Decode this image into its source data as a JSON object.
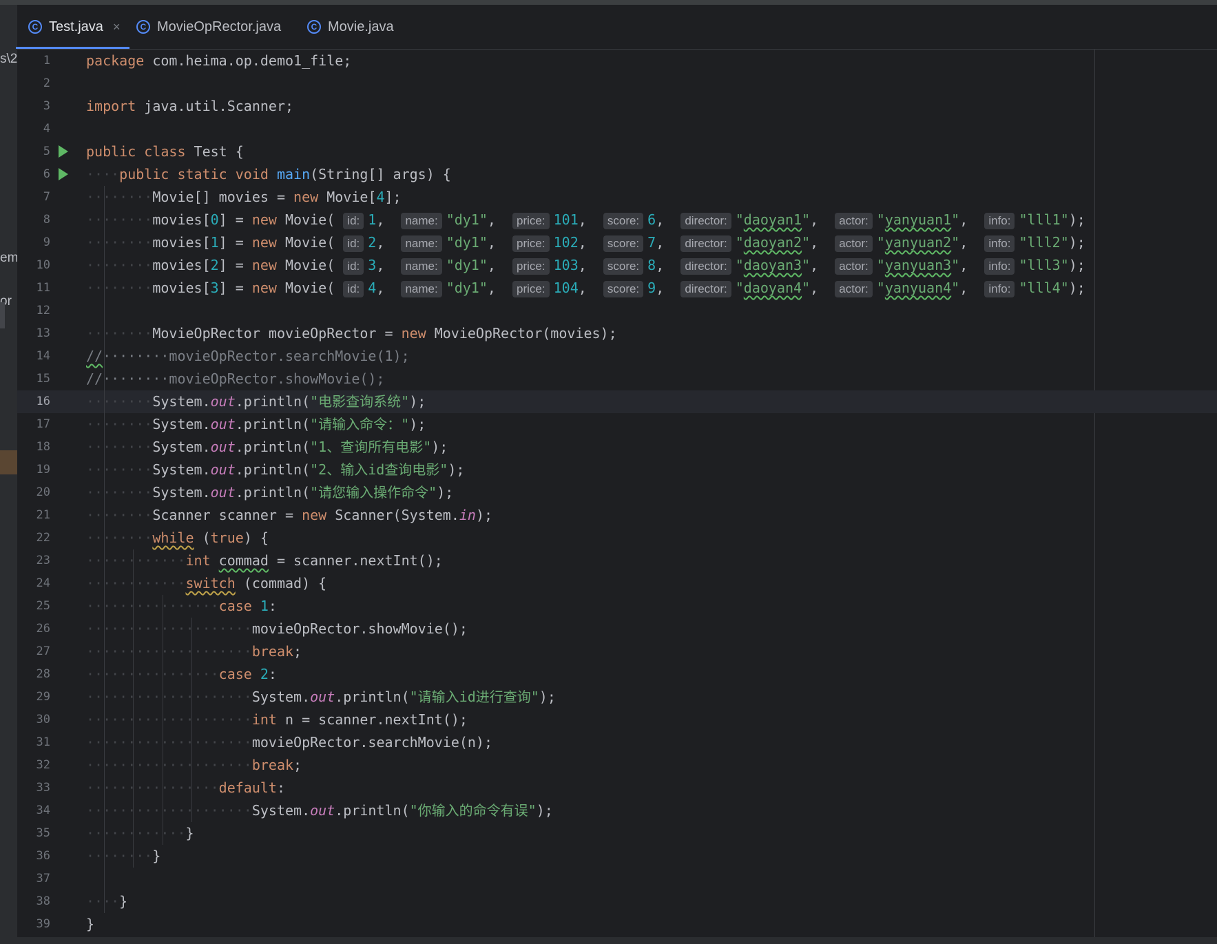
{
  "tabs": [
    {
      "label": "Test.java",
      "active": true,
      "close": "×"
    },
    {
      "label": "MovieOpRector.java",
      "active": false
    },
    {
      "label": "Movie.java",
      "active": false
    }
  ],
  "left_panel_fragments": [
    "s\\2",
    "em",
    "or"
  ],
  "code_lines": [
    {
      "n": "1",
      "parts": [
        {
          "t": "package",
          "c": "kw"
        },
        {
          "t": " com.heima.op.demo1_file;"
        }
      ]
    },
    {
      "n": "2",
      "parts": []
    },
    {
      "n": "3",
      "parts": [
        {
          "t": "import",
          "c": "kw"
        },
        {
          "t": " java.util.Scanner;"
        }
      ]
    },
    {
      "n": "4",
      "parts": []
    },
    {
      "n": "5",
      "run": true,
      "parts": [
        {
          "t": "public class",
          "c": "kw"
        },
        {
          "t": " Test {"
        }
      ]
    },
    {
      "n": "6",
      "run": true,
      "parts": [
        {
          "t": "····",
          "c": "dot"
        },
        {
          "t": "public static void",
          "c": "kw"
        },
        {
          "t": " "
        },
        {
          "t": "main",
          "c": "fn"
        },
        {
          "t": "(String[] args) {"
        }
      ]
    },
    {
      "n": "7",
      "parts": [
        {
          "t": "········",
          "c": "dot"
        },
        {
          "t": "Movie[] movies = "
        },
        {
          "t": "new",
          "c": "kw"
        },
        {
          "t": " Movie["
        },
        {
          "t": "4",
          "c": "num"
        },
        {
          "t": "];"
        }
      ]
    },
    {
      "n": "8",
      "parts": [
        {
          "t": "········",
          "c": "dot"
        },
        {
          "t": "movies["
        },
        {
          "t": "0",
          "c": "num"
        },
        {
          "t": "] = "
        },
        {
          "t": "new",
          "c": "kw"
        },
        {
          "t": " Movie( "
        },
        {
          "h": "id:"
        },
        {
          "t": "1",
          "c": "num"
        },
        {
          "t": ",  "
        },
        {
          "h": "name:"
        },
        {
          "t": "\"dy1\"",
          "c": "str"
        },
        {
          "t": ",  "
        },
        {
          "h": "price:"
        },
        {
          "t": "101",
          "c": "num"
        },
        {
          "t": ",  "
        },
        {
          "h": "score:"
        },
        {
          "t": "6",
          "c": "num"
        },
        {
          "t": ",  "
        },
        {
          "h": "director:"
        },
        {
          "t": "\"",
          "c": "str"
        },
        {
          "t": "daoyan1",
          "c": "str squig"
        },
        {
          "t": "\"",
          "c": "str"
        },
        {
          "t": ",  "
        },
        {
          "h": "actor:"
        },
        {
          "t": "\"",
          "c": "str"
        },
        {
          "t": "yanyuan1",
          "c": "str squig"
        },
        {
          "t": "\"",
          "c": "str"
        },
        {
          "t": ",  "
        },
        {
          "h": "info:"
        },
        {
          "t": "\"lll1\"",
          "c": "str"
        },
        {
          "t": ");"
        }
      ]
    },
    {
      "n": "9",
      "parts": [
        {
          "t": "········",
          "c": "dot"
        },
        {
          "t": "movies["
        },
        {
          "t": "1",
          "c": "num"
        },
        {
          "t": "] = "
        },
        {
          "t": "new",
          "c": "kw"
        },
        {
          "t": " Movie( "
        },
        {
          "h": "id:"
        },
        {
          "t": "2",
          "c": "num"
        },
        {
          "t": ",  "
        },
        {
          "h": "name:"
        },
        {
          "t": "\"dy1\"",
          "c": "str"
        },
        {
          "t": ",  "
        },
        {
          "h": "price:"
        },
        {
          "t": "102",
          "c": "num"
        },
        {
          "t": ",  "
        },
        {
          "h": "score:"
        },
        {
          "t": "7",
          "c": "num"
        },
        {
          "t": ",  "
        },
        {
          "h": "director:"
        },
        {
          "t": "\"",
          "c": "str"
        },
        {
          "t": "daoyan2",
          "c": "str squig"
        },
        {
          "t": "\"",
          "c": "str"
        },
        {
          "t": ",  "
        },
        {
          "h": "actor:"
        },
        {
          "t": "\"",
          "c": "str"
        },
        {
          "t": "yanyuan2",
          "c": "str squig"
        },
        {
          "t": "\"",
          "c": "str"
        },
        {
          "t": ",  "
        },
        {
          "h": "info:"
        },
        {
          "t": "\"lll2\"",
          "c": "str"
        },
        {
          "t": ");"
        }
      ]
    },
    {
      "n": "10",
      "parts": [
        {
          "t": "········",
          "c": "dot"
        },
        {
          "t": "movies["
        },
        {
          "t": "2",
          "c": "num"
        },
        {
          "t": "] = "
        },
        {
          "t": "new",
          "c": "kw"
        },
        {
          "t": " Movie( "
        },
        {
          "h": "id:"
        },
        {
          "t": "3",
          "c": "num"
        },
        {
          "t": ",  "
        },
        {
          "h": "name:"
        },
        {
          "t": "\"dy1\"",
          "c": "str"
        },
        {
          "t": ",  "
        },
        {
          "h": "price:"
        },
        {
          "t": "103",
          "c": "num"
        },
        {
          "t": ",  "
        },
        {
          "h": "score:"
        },
        {
          "t": "8",
          "c": "num"
        },
        {
          "t": ",  "
        },
        {
          "h": "director:"
        },
        {
          "t": "\"",
          "c": "str"
        },
        {
          "t": "daoyan3",
          "c": "str squig"
        },
        {
          "t": "\"",
          "c": "str"
        },
        {
          "t": ",  "
        },
        {
          "h": "actor:"
        },
        {
          "t": "\"",
          "c": "str"
        },
        {
          "t": "yanyuan3",
          "c": "str squig"
        },
        {
          "t": "\"",
          "c": "str"
        },
        {
          "t": ",  "
        },
        {
          "h": "info:"
        },
        {
          "t": "\"lll3\"",
          "c": "str"
        },
        {
          "t": ");"
        }
      ]
    },
    {
      "n": "11",
      "parts": [
        {
          "t": "········",
          "c": "dot"
        },
        {
          "t": "movies["
        },
        {
          "t": "3",
          "c": "num"
        },
        {
          "t": "] = "
        },
        {
          "t": "new",
          "c": "kw"
        },
        {
          "t": " Movie( "
        },
        {
          "h": "id:"
        },
        {
          "t": "4",
          "c": "num"
        },
        {
          "t": ",  "
        },
        {
          "h": "name:"
        },
        {
          "t": "\"dy1\"",
          "c": "str"
        },
        {
          "t": ",  "
        },
        {
          "h": "price:"
        },
        {
          "t": "104",
          "c": "num"
        },
        {
          "t": ",  "
        },
        {
          "h": "score:"
        },
        {
          "t": "9",
          "c": "num"
        },
        {
          "t": ",  "
        },
        {
          "h": "director:"
        },
        {
          "t": "\"",
          "c": "str"
        },
        {
          "t": "daoyan4",
          "c": "str squig"
        },
        {
          "t": "\"",
          "c": "str"
        },
        {
          "t": ",  "
        },
        {
          "h": "actor:"
        },
        {
          "t": "\"",
          "c": "str"
        },
        {
          "t": "yanyuan4",
          "c": "str squig"
        },
        {
          "t": "\"",
          "c": "str"
        },
        {
          "t": ",  "
        },
        {
          "h": "info:"
        },
        {
          "t": "\"lll4\"",
          "c": "str"
        },
        {
          "t": ");"
        }
      ]
    },
    {
      "n": "12",
      "parts": []
    },
    {
      "n": "13",
      "parts": [
        {
          "t": "········",
          "c": "dot"
        },
        {
          "t": "MovieOpRector movieOpRector = "
        },
        {
          "t": "new",
          "c": "kw"
        },
        {
          "t": " MovieOpRector(movies);"
        }
      ]
    },
    {
      "n": "14",
      "parts": [
        {
          "t": "//",
          "c": "cmt squig"
        },
        {
          "t": "········movieOpRector.searchMovie(1);",
          "c": "cmt"
        }
      ]
    },
    {
      "n": "15",
      "parts": [
        {
          "t": "//········movieOpRector.showMovie();",
          "c": "cmt"
        }
      ]
    },
    {
      "n": "16",
      "current": true,
      "parts": [
        {
          "t": "········",
          "c": "dot"
        },
        {
          "t": "System."
        },
        {
          "t": "out",
          "c": "fld"
        },
        {
          "t": ".println("
        },
        {
          "t": "\"电影查询系统\"",
          "c": "str"
        },
        {
          "t": ");"
        }
      ]
    },
    {
      "n": "17",
      "parts": [
        {
          "t": "········",
          "c": "dot"
        },
        {
          "t": "System."
        },
        {
          "t": "out",
          "c": "fld"
        },
        {
          "t": ".println("
        },
        {
          "t": "\"请输入命令：\"",
          "c": "str"
        },
        {
          "t": ");"
        }
      ]
    },
    {
      "n": "18",
      "parts": [
        {
          "t": "········",
          "c": "dot"
        },
        {
          "t": "System."
        },
        {
          "t": "out",
          "c": "fld"
        },
        {
          "t": ".println("
        },
        {
          "t": "\"1、查询所有电影\"",
          "c": "str"
        },
        {
          "t": ");"
        }
      ]
    },
    {
      "n": "19",
      "parts": [
        {
          "t": "········",
          "c": "dot"
        },
        {
          "t": "System."
        },
        {
          "t": "out",
          "c": "fld"
        },
        {
          "t": ".println("
        },
        {
          "t": "\"2、输入id查询电影\"",
          "c": "str"
        },
        {
          "t": ");"
        }
      ]
    },
    {
      "n": "20",
      "parts": [
        {
          "t": "········",
          "c": "dot"
        },
        {
          "t": "System."
        },
        {
          "t": "out",
          "c": "fld"
        },
        {
          "t": ".println("
        },
        {
          "t": "\"请您输入操作命令\"",
          "c": "str"
        },
        {
          "t": ");"
        }
      ]
    },
    {
      "n": "21",
      "parts": [
        {
          "t": "········",
          "c": "dot"
        },
        {
          "t": "Scanner scanner = "
        },
        {
          "t": "new",
          "c": "kw"
        },
        {
          "t": " Scanner(System."
        },
        {
          "t": "in",
          "c": "fld"
        },
        {
          "t": ");"
        }
      ]
    },
    {
      "n": "22",
      "parts": [
        {
          "t": "········",
          "c": "dot"
        },
        {
          "t": "while",
          "c": "kw squigw"
        },
        {
          "t": " ("
        },
        {
          "t": "true",
          "c": "kw"
        },
        {
          "t": ") {"
        }
      ]
    },
    {
      "n": "23",
      "parts": [
        {
          "t": "············",
          "c": "dot"
        },
        {
          "t": "int",
          "c": "kw"
        },
        {
          "t": " "
        },
        {
          "t": "commad",
          "c": "squig"
        },
        {
          "t": " = scanner.nextInt();"
        }
      ]
    },
    {
      "n": "24",
      "parts": [
        {
          "t": "············",
          "c": "dot"
        },
        {
          "t": "switch",
          "c": "kw squigw"
        },
        {
          "t": " (commad) {"
        }
      ]
    },
    {
      "n": "25",
      "parts": [
        {
          "t": "················",
          "c": "dot"
        },
        {
          "t": "case",
          "c": "kw"
        },
        {
          "t": " "
        },
        {
          "t": "1",
          "c": "num"
        },
        {
          "t": ":"
        }
      ]
    },
    {
      "n": "26",
      "parts": [
        {
          "t": "····················",
          "c": "dot"
        },
        {
          "t": "movieOpRector.showMovie();"
        }
      ]
    },
    {
      "n": "27",
      "parts": [
        {
          "t": "····················",
          "c": "dot"
        },
        {
          "t": "break",
          "c": "kw"
        },
        {
          "t": ";"
        }
      ]
    },
    {
      "n": "28",
      "parts": [
        {
          "t": "················",
          "c": "dot"
        },
        {
          "t": "case",
          "c": "kw"
        },
        {
          "t": " "
        },
        {
          "t": "2",
          "c": "num"
        },
        {
          "t": ":"
        }
      ]
    },
    {
      "n": "29",
      "parts": [
        {
          "t": "····················",
          "c": "dot"
        },
        {
          "t": "System."
        },
        {
          "t": "out",
          "c": "fld"
        },
        {
          "t": ".println("
        },
        {
          "t": "\"请输入id进行查询\"",
          "c": "str"
        },
        {
          "t": ");"
        }
      ]
    },
    {
      "n": "30",
      "parts": [
        {
          "t": "····················",
          "c": "dot"
        },
        {
          "t": "int",
          "c": "kw"
        },
        {
          "t": " n = scanner.nextInt();"
        }
      ]
    },
    {
      "n": "31",
      "parts": [
        {
          "t": "····················",
          "c": "dot"
        },
        {
          "t": "movieOpRector.searchMovie(n);"
        }
      ]
    },
    {
      "n": "32",
      "parts": [
        {
          "t": "····················",
          "c": "dot"
        },
        {
          "t": "break",
          "c": "kw"
        },
        {
          "t": ";"
        }
      ]
    },
    {
      "n": "33",
      "parts": [
        {
          "t": "················",
          "c": "dot"
        },
        {
          "t": "default",
          "c": "kw"
        },
        {
          "t": ":"
        }
      ]
    },
    {
      "n": "34",
      "parts": [
        {
          "t": "····················",
          "c": "dot"
        },
        {
          "t": "System."
        },
        {
          "t": "out",
          "c": "fld"
        },
        {
          "t": ".println("
        },
        {
          "t": "\"你输入的命令有误\"",
          "c": "str"
        },
        {
          "t": ");"
        }
      ]
    },
    {
      "n": "35",
      "parts": [
        {
          "t": "············",
          "c": "dot"
        },
        {
          "t": "}"
        }
      ]
    },
    {
      "n": "36",
      "parts": [
        {
          "t": "········",
          "c": "dot"
        },
        {
          "t": "}"
        }
      ]
    },
    {
      "n": "37",
      "parts": []
    },
    {
      "n": "38",
      "parts": [
        {
          "t": "····",
          "c": "dot"
        },
        {
          "t": "}"
        }
      ]
    },
    {
      "n": "39",
      "parts": [
        {
          "t": "}"
        }
      ]
    }
  ]
}
